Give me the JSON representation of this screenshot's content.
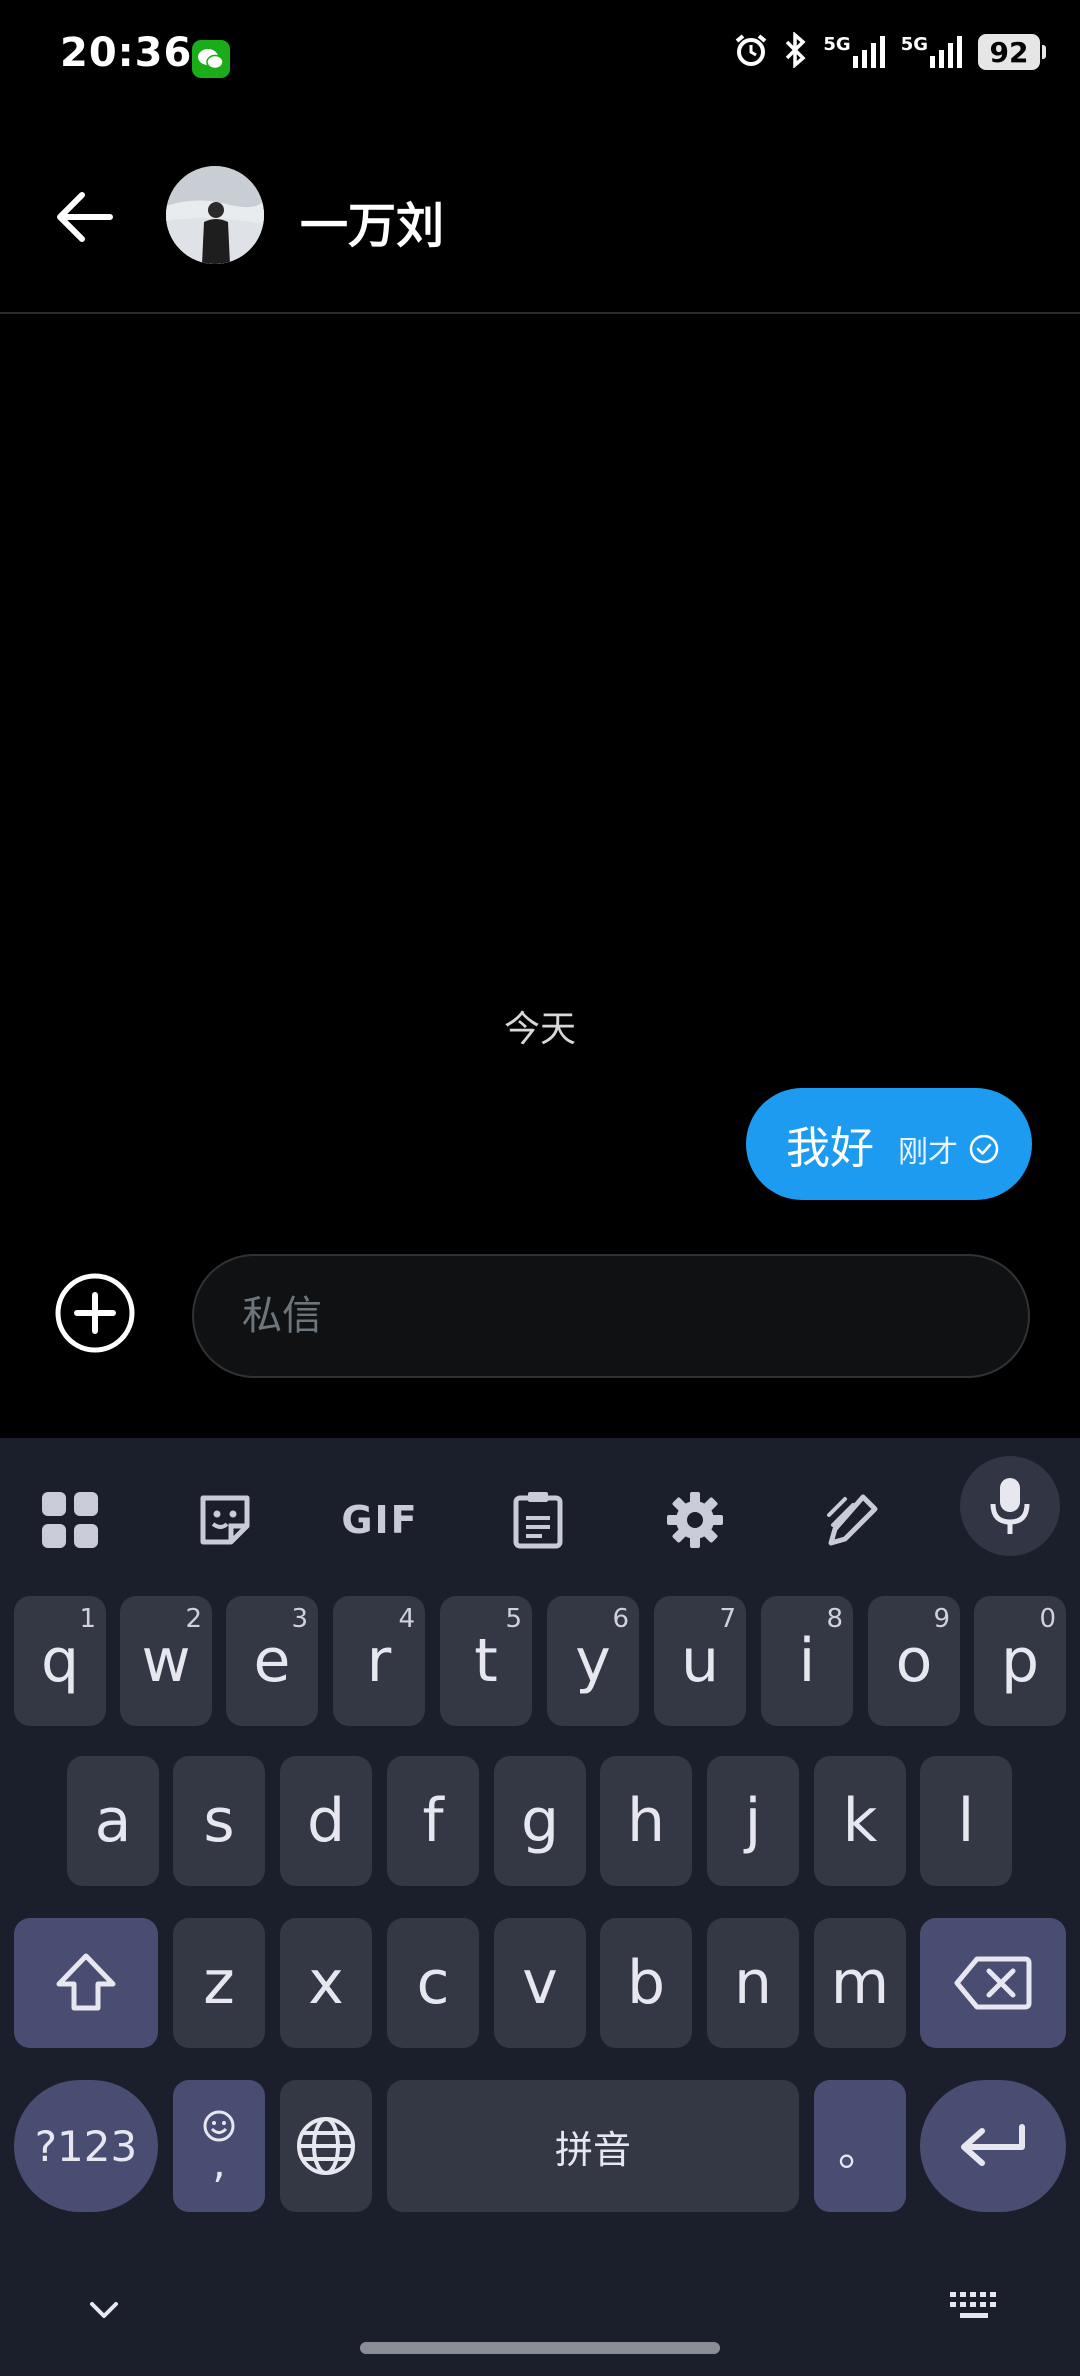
{
  "status_bar": {
    "time": "20:36",
    "signal1_label": "5G",
    "signal2_label": "5G",
    "battery": "92"
  },
  "header": {
    "contact_name": "一万刘"
  },
  "chat": {
    "date_label": "今天",
    "messages": [
      {
        "text": "我好",
        "time": "刚才",
        "status": "sent"
      }
    ]
  },
  "composer": {
    "placeholder": "私信"
  },
  "keyboard": {
    "toolbar": [
      "apps-icon",
      "sticker-icon",
      "gif-icon",
      "clipboard-icon",
      "settings-icon",
      "handwriting-icon",
      "mic-icon"
    ],
    "gif_label": "GIF",
    "row1": [
      {
        "key": "q",
        "hint": "1"
      },
      {
        "key": "w",
        "hint": "2"
      },
      {
        "key": "e",
        "hint": "3"
      },
      {
        "key": "r",
        "hint": "4"
      },
      {
        "key": "t",
        "hint": "5"
      },
      {
        "key": "y",
        "hint": "6"
      },
      {
        "key": "u",
        "hint": "7"
      },
      {
        "key": "i",
        "hint": "8"
      },
      {
        "key": "o",
        "hint": "9"
      },
      {
        "key": "p",
        "hint": "0"
      }
    ],
    "row2": [
      "a",
      "s",
      "d",
      "f",
      "g",
      "h",
      "j",
      "k",
      "l"
    ],
    "row3": [
      "z",
      "x",
      "c",
      "v",
      "b",
      "n",
      "m"
    ],
    "symbols_label": "?123",
    "comma_label": ",",
    "space_label": "拼音",
    "period_label": "。"
  },
  "colors": {
    "accent": "#1d9bf0",
    "keyboard_bg": "#1b1e2b",
    "key_bg": "#343744",
    "func_key_bg": "#4a4d72",
    "wechat_green": "#1aad19"
  }
}
